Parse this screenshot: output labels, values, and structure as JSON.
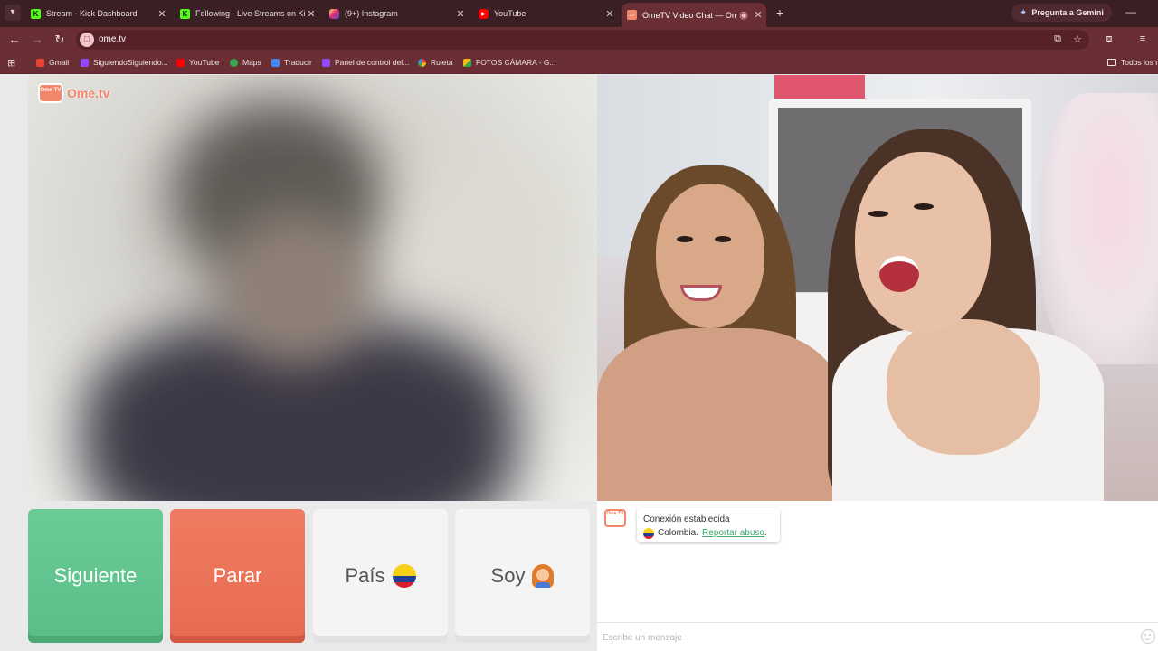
{
  "browser": {
    "tabs": [
      {
        "title": "Stream - Kick Dashboard",
        "favicon": "kick-icon",
        "color": "#53fc18"
      },
      {
        "title": "Following - Live Streams on Kick",
        "favicon": "kick-icon",
        "color": "#53fc18"
      },
      {
        "title": "(9+) Instagram",
        "favicon": "instagram-icon",
        "color": "#e1306c"
      },
      {
        "title": "YouTube",
        "favicon": "youtube-icon",
        "color": "#ff0000"
      },
      {
        "title": "OmeTV Video Chat — Omegle",
        "favicon": "ometv-icon",
        "color": "#f0866c",
        "active": true
      }
    ],
    "gemini_button": "Pregunta a Gemini",
    "url": "ome.tv",
    "bookmarks": [
      {
        "label": "Gmail",
        "color": "#ea4335"
      },
      {
        "label": "SiguiendoSiguiendo...",
        "color": "#9146ff"
      },
      {
        "label": "YouTube",
        "color": "#ff0000"
      },
      {
        "label": "Maps",
        "color": "#34a853"
      },
      {
        "label": "Traducir",
        "color": "#4285f4"
      },
      {
        "label": "Panel de control del...",
        "color": "#9146ff"
      },
      {
        "label": "Ruleta",
        "color": "#fbbc05"
      },
      {
        "label": "FOTOS CÁMARA - G...",
        "color": "#34a853"
      }
    ],
    "all_bookmarks": "Todos los m"
  },
  "app": {
    "logo_text": "Ome.tv",
    "logo_badge": "Ome TV",
    "buttons": {
      "next": "Siguiente",
      "stop": "Parar",
      "country": "País",
      "gender": "Soy"
    },
    "chat": {
      "status_line": "Conexión establecida",
      "country": "Colombia.",
      "report_link": "Reportar abuso",
      "report_suffix": ".",
      "input_placeholder": "Escribe un mensaje"
    }
  },
  "colors": {
    "next": "#5abd87",
    "stop": "#e76a50",
    "brand": "#f0866c"
  }
}
